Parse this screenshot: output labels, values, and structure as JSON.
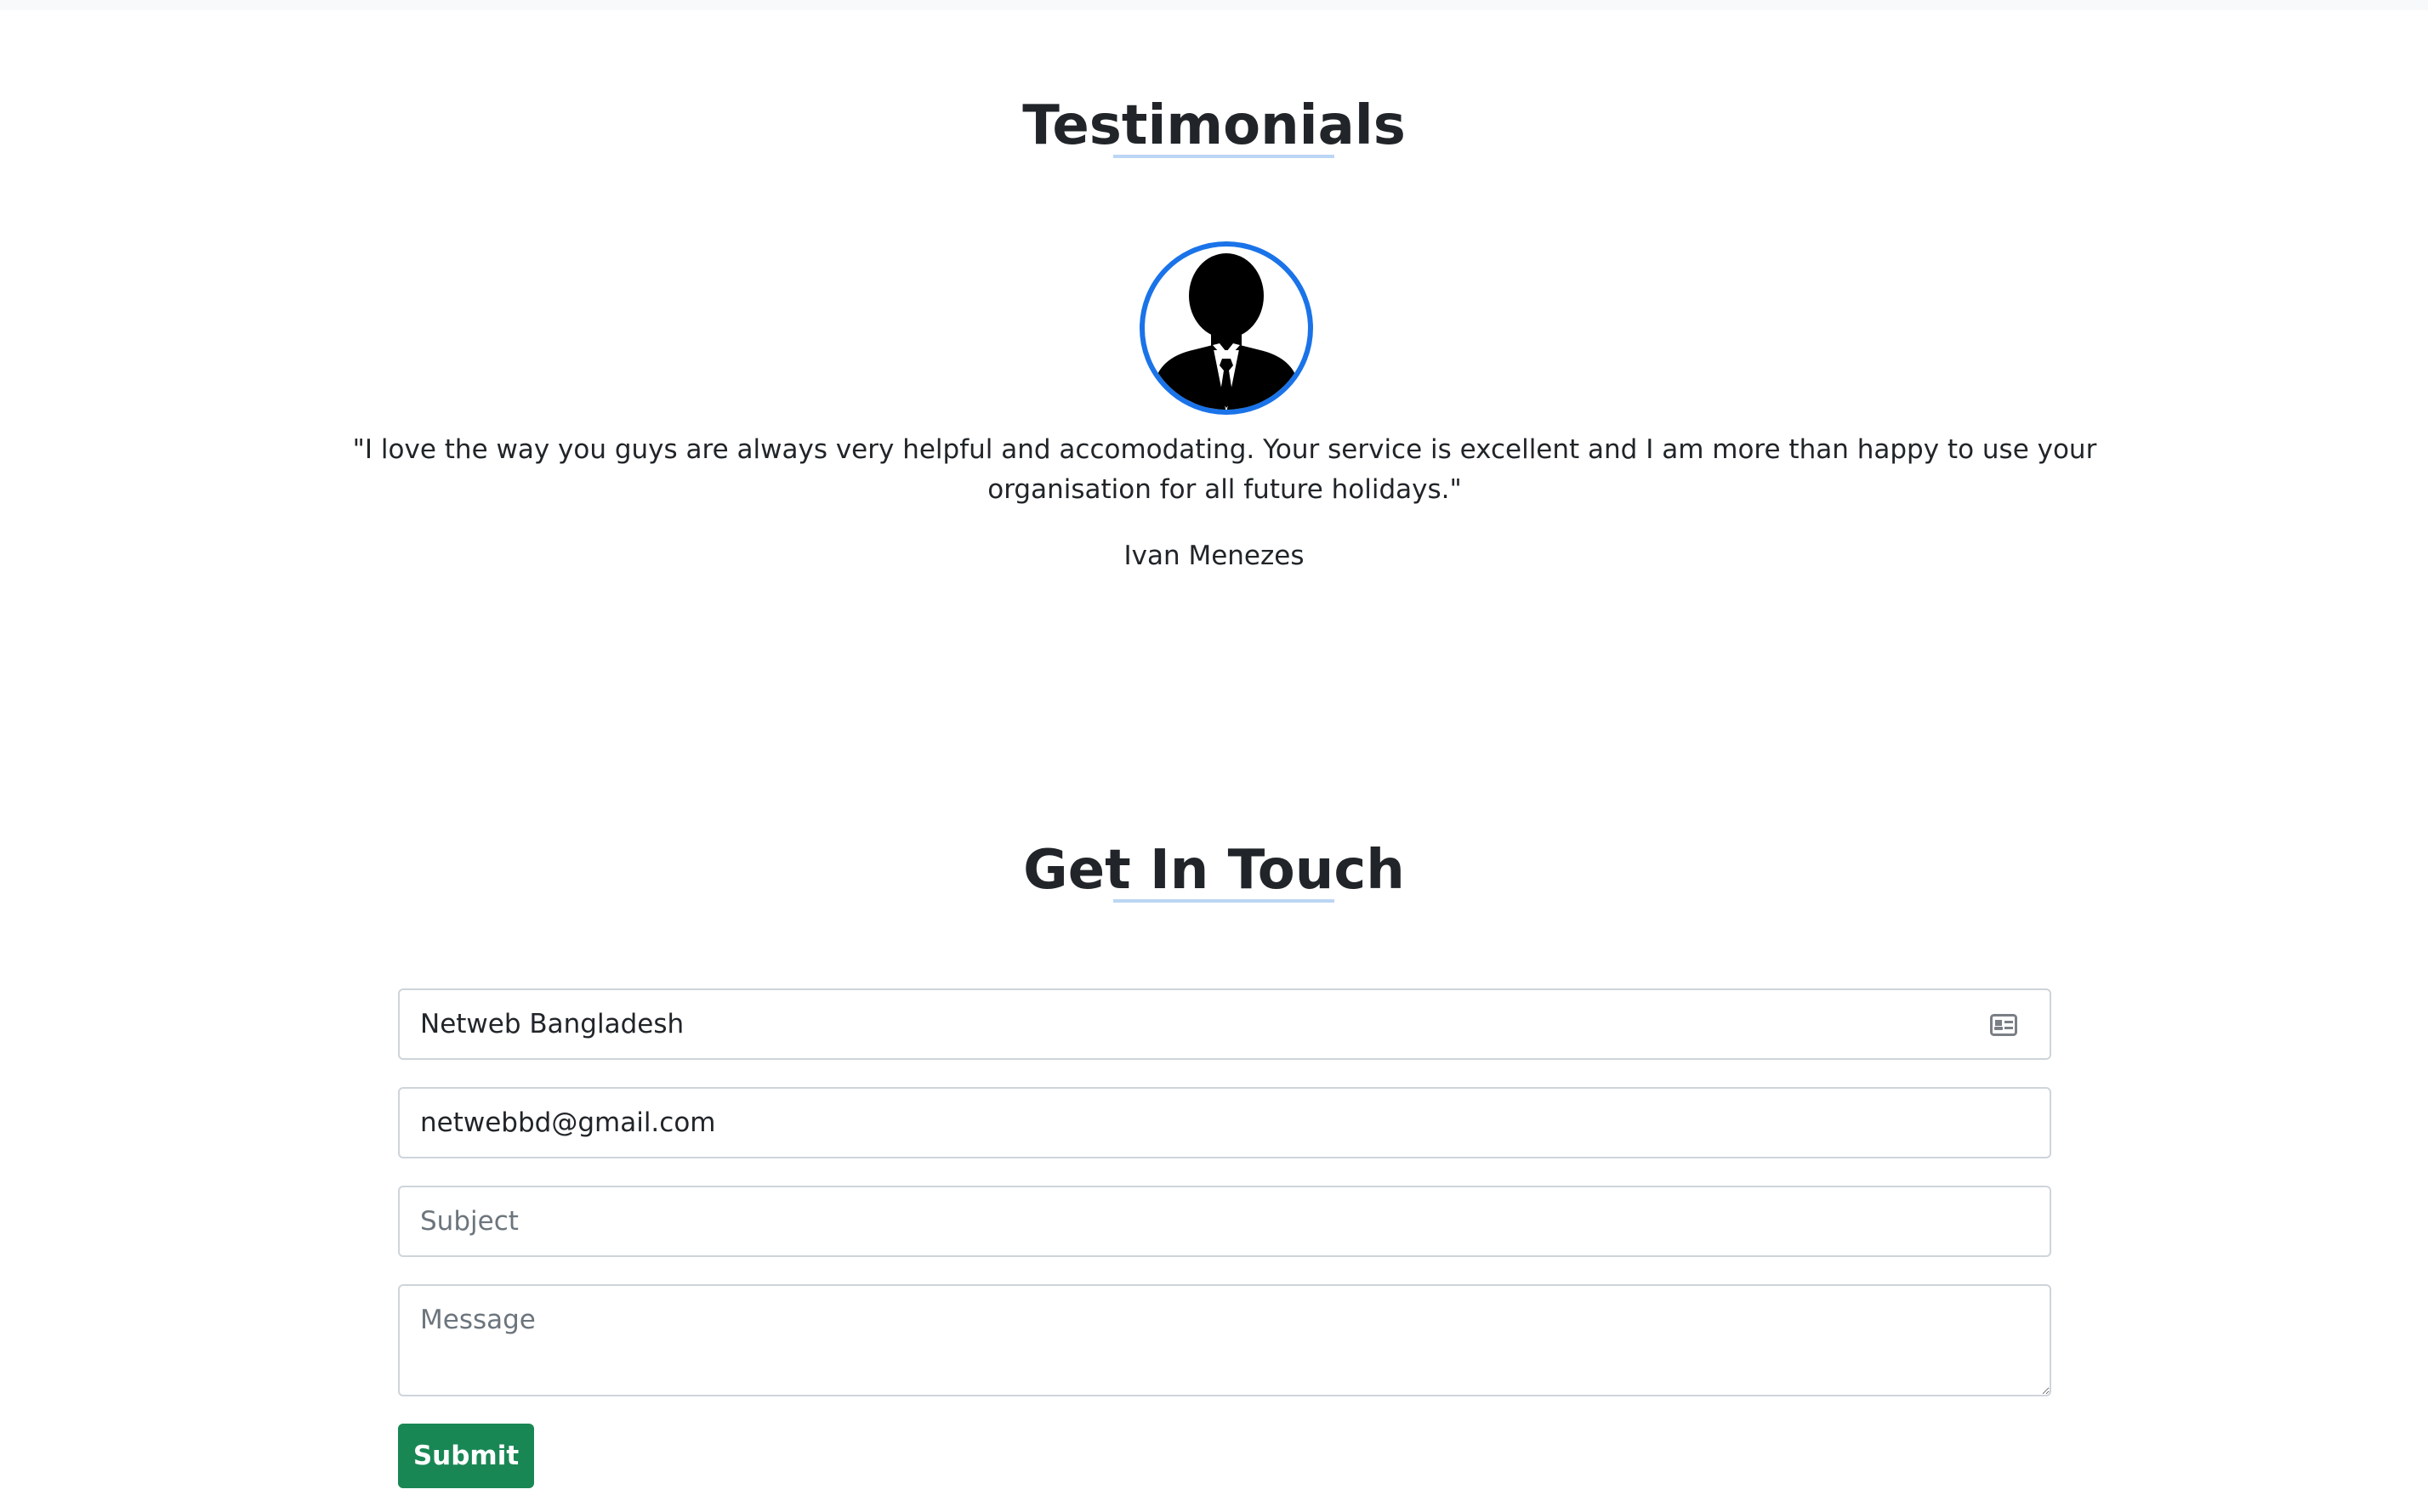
{
  "testimonials": {
    "title": "Testimonials",
    "avatar_icon": "person-silhouette-icon",
    "quote": "\"I love the way you guys are always very helpful and accomodating. Your service is excellent and I am more than happy to use your organisation for all future holidays.\"",
    "author": "Ivan Menezes"
  },
  "contact": {
    "title": "Get In Touch",
    "name_value": "Netweb Bangladesh",
    "name_icon": "contact-card-icon",
    "email_value": "netwebbd@gmail.com",
    "subject_placeholder": "Subject",
    "message_placeholder": "Message",
    "submit_label": "Submit",
    "submit_color": "#198754"
  },
  "colors": {
    "accent": "#1a73e8",
    "underline": "#bcd6f4"
  }
}
